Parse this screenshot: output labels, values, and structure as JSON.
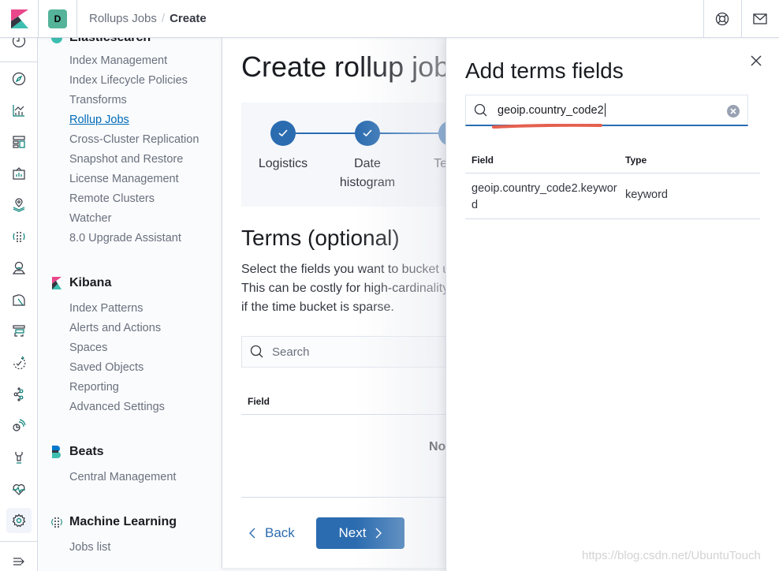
{
  "header": {
    "space_initial": "D",
    "breadcrumb": {
      "parent": "Rollups Jobs",
      "separator": "/",
      "current": "Create"
    },
    "icons": [
      "help-icon",
      "newsfeed-icon"
    ]
  },
  "nav_rail": {
    "icons": [
      "recently-viewed-icon",
      "discover-icon",
      "visualize-icon",
      "dashboard-icon",
      "canvas-icon",
      "maps-icon",
      "machine-learning-icon",
      "metrics-icon",
      "logs-icon",
      "apm-icon",
      "uptime-icon",
      "siem-icon",
      "graph-icon",
      "dev-tools-icon",
      "stack-monitoring-icon",
      "management-icon",
      "collapse-icon"
    ]
  },
  "sidenav": {
    "elasticsearch": {
      "title": "Elasticsearch",
      "items": [
        "Index Management",
        "Index Lifecycle Policies",
        "Transforms",
        "Rollup Jobs",
        "Cross-Cluster Replication",
        "Snapshot and Restore",
        "License Management",
        "Remote Clusters",
        "Watcher",
        "8.0 Upgrade Assistant"
      ],
      "active": "Rollup Jobs"
    },
    "kibana": {
      "title": "Kibana",
      "items": [
        "Index Patterns",
        "Alerts and Actions",
        "Spaces",
        "Saved Objects",
        "Reporting",
        "Advanced Settings"
      ]
    },
    "beats": {
      "title": "Beats",
      "items": [
        "Central Management"
      ]
    },
    "ml": {
      "title": "Machine Learning",
      "items": [
        "Jobs list"
      ]
    }
  },
  "page": {
    "title": "Create rollup job",
    "steps": [
      {
        "label": "Logistics",
        "complete": true
      },
      {
        "label": "Date histogram",
        "label_line1": "Date",
        "label_line2": "histogram",
        "complete": true
      },
      {
        "label": "Terms",
        "complete": false
      }
    ],
    "terms_title": "Terms (optional)",
    "terms_desc": [
      "Select the fields you want to bucket using terms aggregations.",
      "This can be costly for high-cardinality fields such as IP addresses and",
      "if the time bucket is sparse."
    ],
    "search_placeholder": "Search",
    "table_header": "Field",
    "empty_message": "No items found",
    "back_label": "Back",
    "next_label": "Next"
  },
  "flyout": {
    "title": "Add terms fields",
    "search_value": "geoip.country_code2",
    "columns": [
      "Field",
      "Type"
    ],
    "rows": [
      {
        "field": "geoip.country_code2.keyword",
        "type": "keyword"
      }
    ]
  },
  "watermark": "https://blog.csdn.net/UbuntuTouch",
  "colors": {
    "primary": "#2b6cb0",
    "link": "#006bb8",
    "annotation": "#e5604f",
    "teal": "#54b399"
  }
}
